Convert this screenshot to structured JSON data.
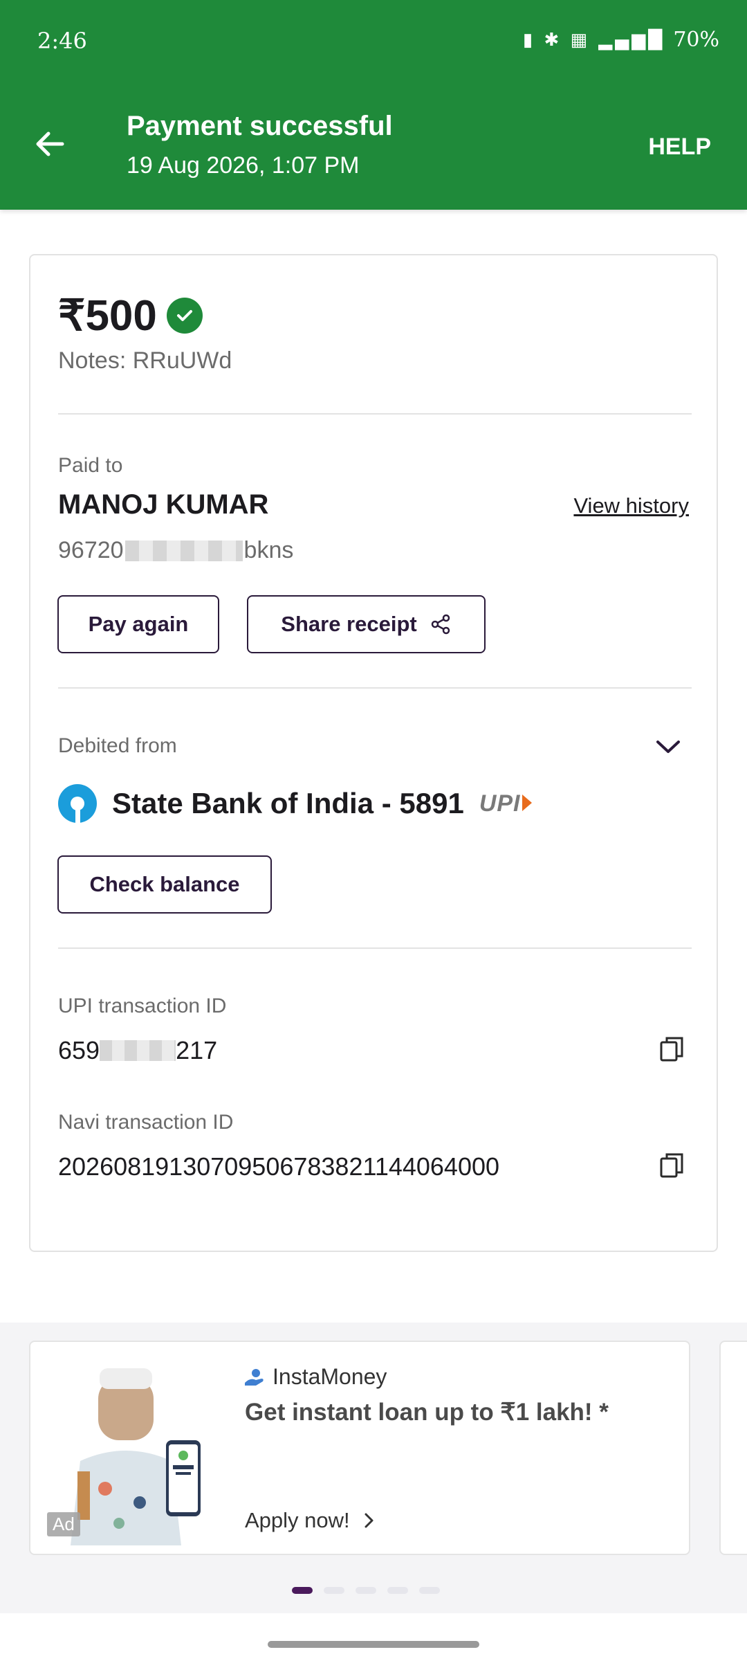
{
  "status_bar": {
    "time": "2:46",
    "icons": "vibrate, bluetooth, VoLTE, 5G, signal",
    "battery": "70%"
  },
  "header": {
    "title": "Payment successful",
    "datetime": "19 Aug 2026, 1:07 PM",
    "help_label": "HELP",
    "background_color": "#1f8a3a"
  },
  "payment": {
    "amount": "₹500",
    "notes": "Notes: RRuUWd"
  },
  "payee": {
    "label": "Paid to",
    "name": "MANOJ KUMAR",
    "view_history_label": "View history",
    "id_prefix": "96720",
    "id_suffix": "bkns",
    "pay_again_label": "Pay again",
    "share_receipt_label": "Share receipt"
  },
  "debit": {
    "label": "Debited from",
    "bank_name": "State Bank of India - 5891",
    "upi_logo_text": "UPI",
    "check_balance_label": "Check balance"
  },
  "transactions": {
    "upi_label": "UPI transaction ID",
    "upi_prefix": "659",
    "upi_suffix": "217",
    "navi_label": "Navi transaction ID",
    "navi_id": "202608191307095067838211440640​00"
  },
  "ad": {
    "brand": "InstaMoney",
    "headline": "Get instant loan up to ₹1 lakh! *",
    "cta": "Apply now!",
    "badge": "Ad"
  },
  "carousel": {
    "total": 5,
    "active_index": 0
  }
}
